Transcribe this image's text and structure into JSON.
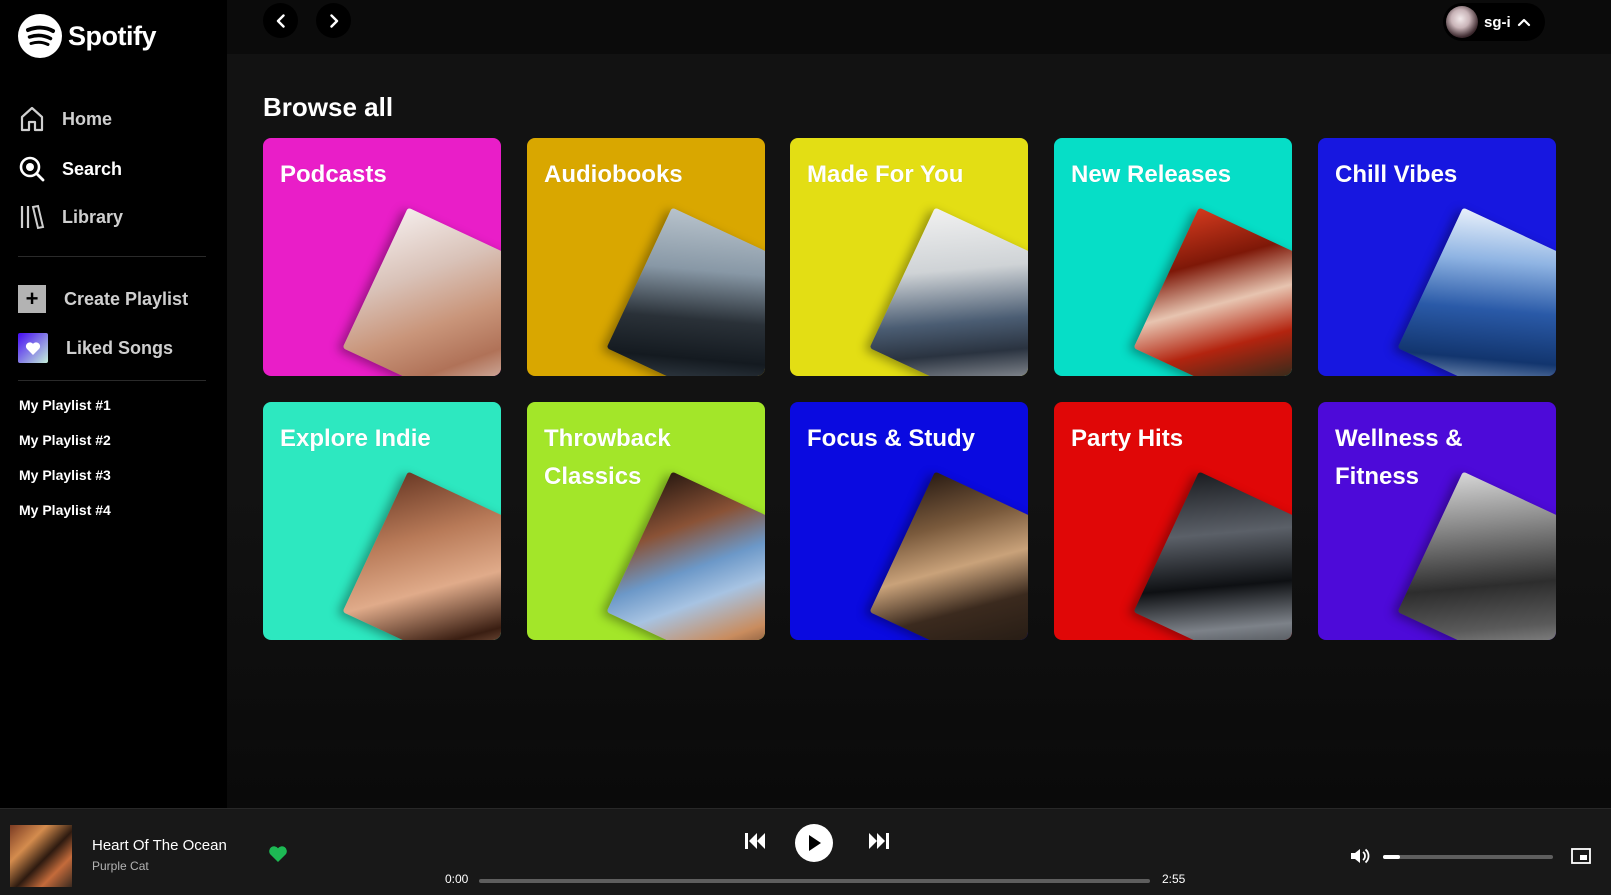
{
  "brand": {
    "name": "Spotify"
  },
  "sidebar": {
    "nav": [
      {
        "label": "Home",
        "icon": "home-icon"
      },
      {
        "label": "Search",
        "icon": "search-icon"
      },
      {
        "label": "Library",
        "icon": "library-icon"
      }
    ],
    "actions": [
      {
        "label": "Create Playlist",
        "icon": "plus-icon"
      },
      {
        "label": "Liked Songs",
        "icon": "heart-icon"
      }
    ],
    "playlists": [
      "My Playlist #1",
      "My Playlist #2",
      "My Playlist #3",
      "My Playlist #4"
    ]
  },
  "header": {
    "user_name": "sg-i"
  },
  "main": {
    "section_title": "Browse all",
    "categories": [
      {
        "title": "Podcasts",
        "color": "#e91ec8"
      },
      {
        "title": "Audiobooks",
        "color": "#d9a700"
      },
      {
        "title": "Made For You",
        "color": "#e3de14"
      },
      {
        "title": "New Releases",
        "color": "#06dec7"
      },
      {
        "title": "Chill Vibes",
        "color": "#1717e0"
      },
      {
        "title": "Explore Indie",
        "color": "#2de8c0"
      },
      {
        "title": "Throwback Classics",
        "color": "#a3e629"
      },
      {
        "title": "Focus & Study",
        "color": "#0a0ae0"
      },
      {
        "title": "Party Hits",
        "color": "#e00707"
      },
      {
        "title": "Wellness & Fitness",
        "color": "#4d0ad9"
      }
    ]
  },
  "player": {
    "track_title": "Heart Of The Ocean",
    "track_artist": "Purple Cat",
    "time_current": "0:00",
    "time_total": "2:55",
    "progress": 0,
    "volume": 0.1,
    "liked": true,
    "accent_color": "#1db954"
  }
}
